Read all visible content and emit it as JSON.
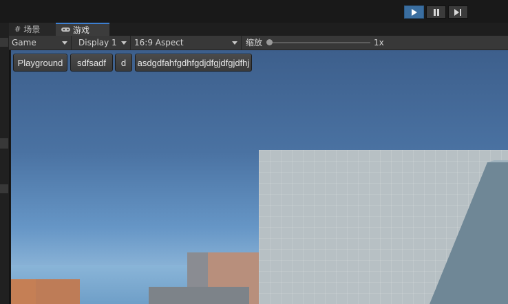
{
  "tabs": [
    {
      "label": "场景",
      "icon": "grid-icon"
    },
    {
      "label": "游戏",
      "icon": "gamepad-icon"
    }
  ],
  "play_controls": {
    "play_icon": "play-icon",
    "pause_icon": "pause-icon",
    "step_icon": "step-icon",
    "play_active": true
  },
  "game_controls": {
    "game_dropdown": "Game",
    "display_dropdown": "Display 1",
    "aspect_dropdown": "16:9 Aspect",
    "scale_label": "缩放",
    "scale_value": "1x"
  },
  "game_buttons": [
    {
      "label": "Playground"
    },
    {
      "label": "sdfsadf"
    },
    {
      "label": "d"
    },
    {
      "label": "asdgdfahfgdhfgdjdfgjdfgjdfhj"
    }
  ],
  "colors": {
    "accent": "#3d7fd1",
    "sky_top": "#3d5f8c",
    "sky_bottom": "#8fb7d9"
  }
}
